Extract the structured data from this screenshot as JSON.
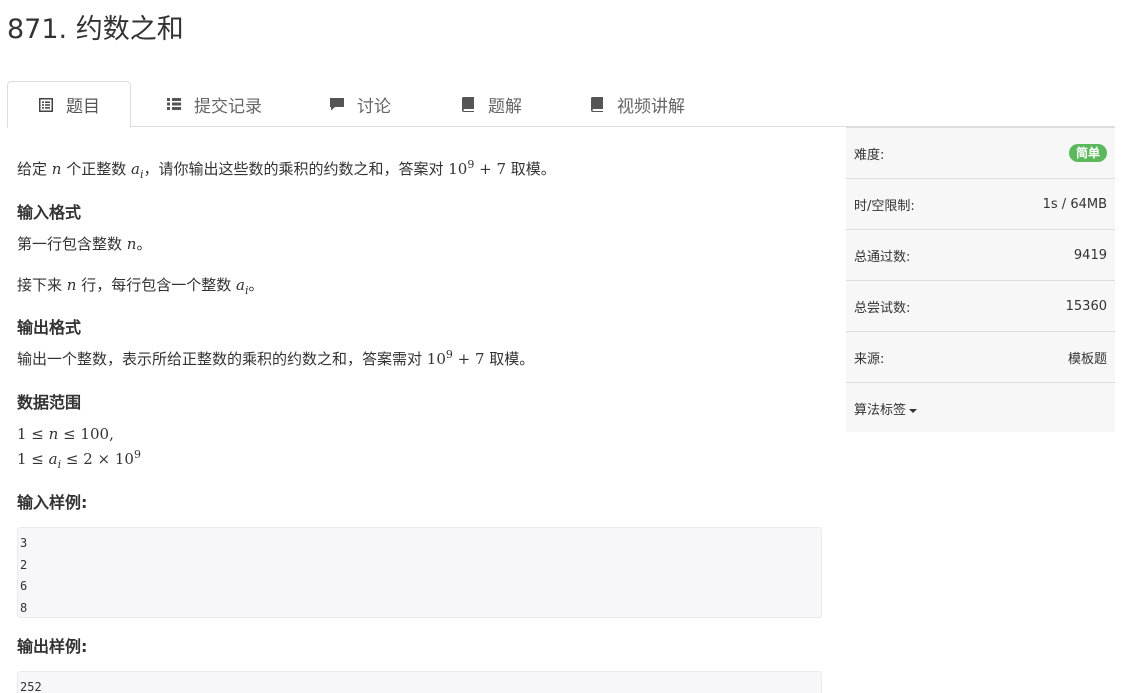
{
  "problem": {
    "title": "871. 约数之和"
  },
  "tabs": [
    {
      "label": "题目",
      "icon": "list-alt-icon"
    },
    {
      "label": "提交记录",
      "icon": "list-icon"
    },
    {
      "label": "讨论",
      "icon": "comment-icon"
    },
    {
      "label": "题解",
      "icon": "book-icon"
    },
    {
      "label": "视频讲解",
      "icon": "book-icon"
    }
  ],
  "description": {
    "p1_a": "给定 ",
    "p1_n": "n",
    "p1_b": " 个正整数 ",
    "p1_a_sym": "a",
    "p1_a_sub": "i",
    "p1_c": "，请你输出这些数的乘积的约数之和，答案对 ",
    "p1_base": "10",
    "p1_exp": "9",
    "p1_plus": " + 7",
    "p1_d": " 取模。"
  },
  "input_format": {
    "heading": "输入格式",
    "line1_a": "第一行包含整数 ",
    "line1_n": "n",
    "line1_b": "。",
    "line2_a": "接下来 ",
    "line2_n": "n",
    "line2_b": " 行，每行包含一个整数 ",
    "line2_a_sym": "a",
    "line2_a_sub": "i",
    "line2_c": "。"
  },
  "output_format": {
    "heading": "输出格式",
    "line_a": "输出一个整数，表示所给正整数的乘积的约数之和，答案需对 ",
    "line_base": "10",
    "line_exp": "9",
    "line_plus": " + 7",
    "line_b": " 取模。"
  },
  "data_range": {
    "heading": "数据范围",
    "r1_a": "1 ≤ ",
    "r1_n": "n",
    "r1_b": " ≤ 100,",
    "r2_a": "1 ≤ ",
    "r2_sym": "a",
    "r2_sub": "i",
    "r2_b": " ≤ 2 × 10",
    "r2_exp": "9"
  },
  "sample_input": {
    "heading": "输入样例:",
    "lines": [
      "3",
      "2",
      "6",
      "8"
    ]
  },
  "sample_output": {
    "heading": "输出样例:",
    "lines": [
      "252"
    ]
  },
  "sidebar": {
    "difficulty_label": "难度:",
    "difficulty_value": "简单",
    "limit_label": "时/空限制:",
    "limit_value": "1s / 64MB",
    "passed_label": "总通过数:",
    "passed_value": "9419",
    "attempts_label": "总尝试数:",
    "attempts_value": "15360",
    "source_label": "来源:",
    "source_value": "模板题",
    "tags_label": "算法标签"
  },
  "colors": {
    "badge_easy": "#5cb85c",
    "sidebar_bg": "#f7f7f7",
    "code_bg": "#f7f7f9"
  }
}
